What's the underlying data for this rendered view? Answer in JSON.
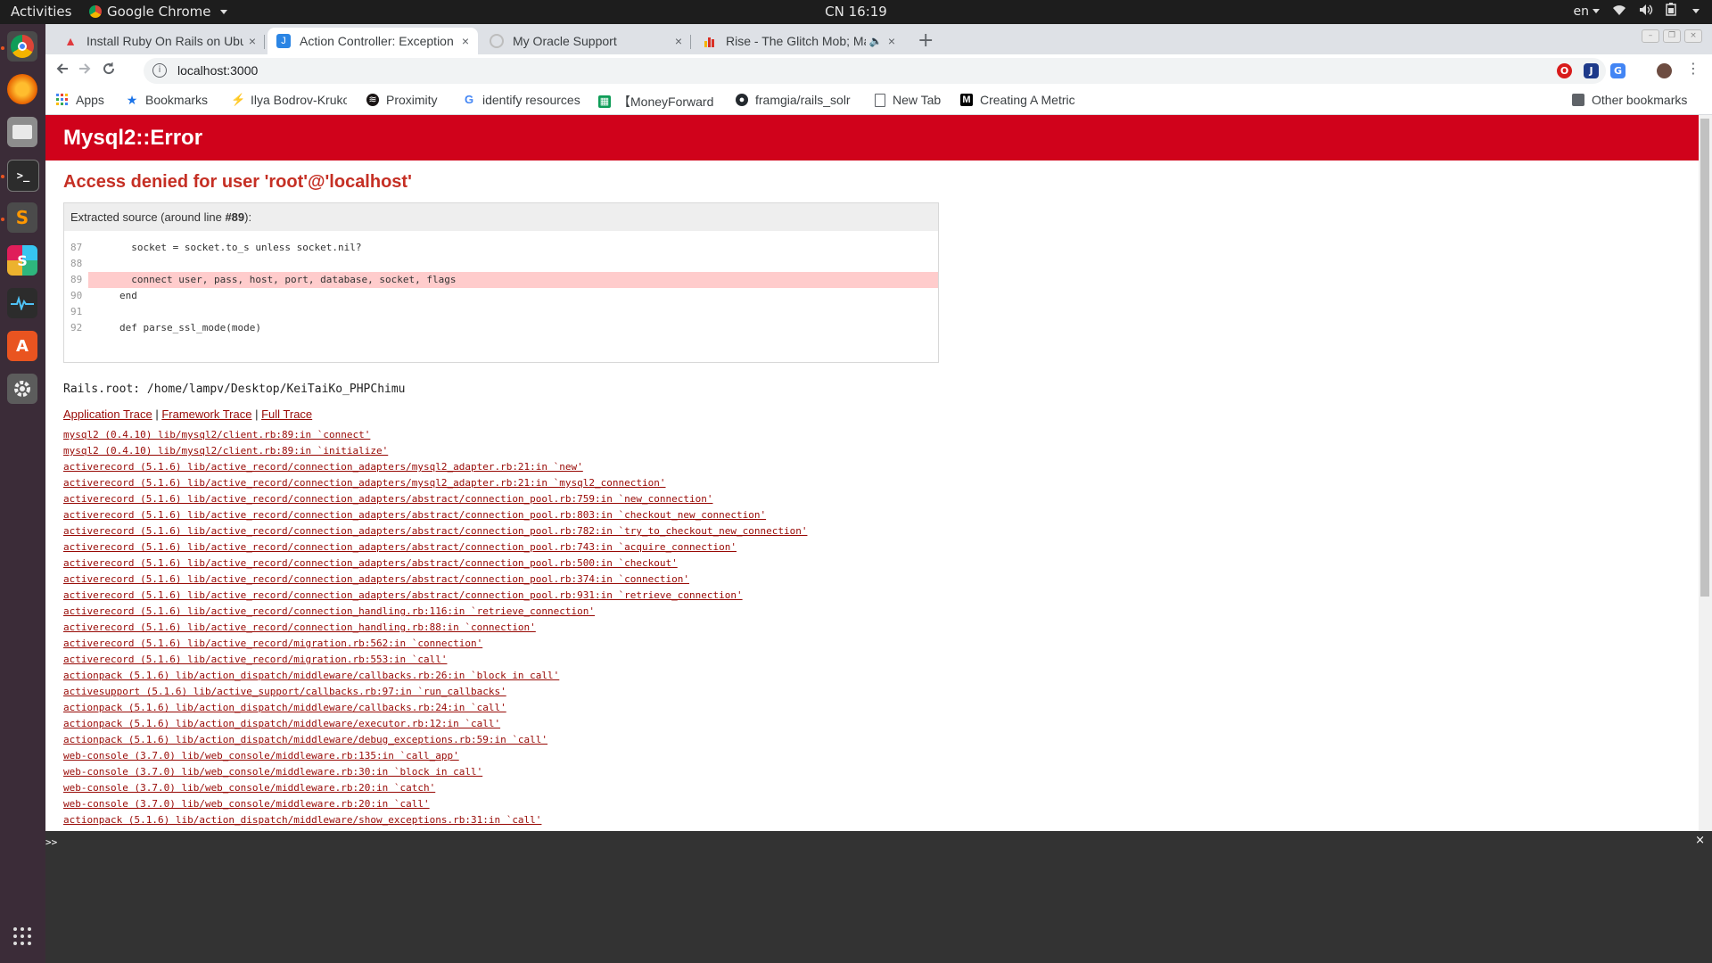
{
  "topbar": {
    "activities": "Activities",
    "app_name": "Google Chrome",
    "clock": "CN 16:19",
    "lang": "en"
  },
  "tabs": [
    {
      "title": "Install Ruby On Rails on Ubuntu",
      "close": "×",
      "favicon": "warning-icon",
      "color": "#e03a3e",
      "active": false
    },
    {
      "title": "Action Controller: Exception caught",
      "close": "×",
      "favicon": "j",
      "color": "#2b85e4",
      "active": true
    },
    {
      "title": "My Oracle Support",
      "close": "×",
      "favicon": "oracle-icon",
      "color": "#bdbdbd",
      "active": false
    },
    {
      "title": "Rise - The Glitch Mob; Mako",
      "close": "×",
      "favicon": "chart-icon",
      "color": "#d93025",
      "active": false
    }
  ],
  "toolbar": {
    "url": "localhost:3000"
  },
  "bookmarks": {
    "items": [
      {
        "label": "Apps",
        "icon": "apps-grid-icon"
      },
      {
        "label": "Bookmarks",
        "icon": "star-icon"
      },
      {
        "label": "Ilya Bodrov-Krukowski",
        "icon": "sitepoint-icon"
      },
      {
        "label": "Proximity",
        "icon": "spotify-icon"
      },
      {
        "label": "identify resources",
        "icon": "google-icon"
      },
      {
        "label": "【MoneyForward",
        "icon": "sheets-icon"
      },
      {
        "label": "framgia/rails_solr",
        "icon": "github-icon"
      },
      {
        "label": "New Tab",
        "icon": "page-icon"
      },
      {
        "label": "Creating A Metric",
        "icon": "medium-icon"
      }
    ],
    "other": "Other bookmarks"
  },
  "error": {
    "title": "Mysql2::Error",
    "message": "Access denied for user 'root'@'localhost'",
    "source_caption_prefix": "Extracted source (around line ",
    "source_line": "#89",
    "source_caption_suffix": "):",
    "source": [
      {
        "num": "87",
        "code": "  socket = socket.to_s unless socket.nil?"
      },
      {
        "num": "88",
        "code": ""
      },
      {
        "num": "89",
        "code": "  connect user, pass, host, port, database, socket, flags",
        "highlight": true
      },
      {
        "num": "90",
        "code": "end"
      },
      {
        "num": "91",
        "code": ""
      },
      {
        "num": "92",
        "code": "def parse_ssl_mode(mode)"
      }
    ],
    "rails_root": "Rails.root: /home/lampv/Desktop/KeiTaiKo_PHPChimu",
    "links": {
      "application": "Application Trace",
      "framework": "Framework Trace",
      "full": "Full Trace",
      "separator": " | "
    },
    "trace": [
      "mysql2 (0.4.10) lib/mysql2/client.rb:89:in `connect'",
      "mysql2 (0.4.10) lib/mysql2/client.rb:89:in `initialize'",
      "activerecord (5.1.6) lib/active_record/connection_adapters/mysql2_adapter.rb:21:in `new'",
      "activerecord (5.1.6) lib/active_record/connection_adapters/mysql2_adapter.rb:21:in `mysql2_connection'",
      "activerecord (5.1.6) lib/active_record/connection_adapters/abstract/connection_pool.rb:759:in `new_connection'",
      "activerecord (5.1.6) lib/active_record/connection_adapters/abstract/connection_pool.rb:803:in `checkout_new_connection'",
      "activerecord (5.1.6) lib/active_record/connection_adapters/abstract/connection_pool.rb:782:in `try_to_checkout_new_connection'",
      "activerecord (5.1.6) lib/active_record/connection_adapters/abstract/connection_pool.rb:743:in `acquire_connection'",
      "activerecord (5.1.6) lib/active_record/connection_adapters/abstract/connection_pool.rb:500:in `checkout'",
      "activerecord (5.1.6) lib/active_record/connection_adapters/abstract/connection_pool.rb:374:in `connection'",
      "activerecord (5.1.6) lib/active_record/connection_adapters/abstract/connection_pool.rb:931:in `retrieve_connection'",
      "activerecord (5.1.6) lib/active_record/connection_handling.rb:116:in `retrieve_connection'",
      "activerecord (5.1.6) lib/active_record/connection_handling.rb:88:in `connection'",
      "activerecord (5.1.6) lib/active_record/migration.rb:562:in `connection'",
      "activerecord (5.1.6) lib/active_record/migration.rb:553:in `call'",
      "actionpack (5.1.6) lib/action_dispatch/middleware/callbacks.rb:26:in `block in call'",
      "activesupport (5.1.6) lib/active_support/callbacks.rb:97:in `run_callbacks'",
      "actionpack (5.1.6) lib/action_dispatch/middleware/callbacks.rb:24:in `call'",
      "actionpack (5.1.6) lib/action_dispatch/middleware/executor.rb:12:in `call'",
      "actionpack (5.1.6) lib/action_dispatch/middleware/debug_exceptions.rb:59:in `call'",
      "web-console (3.7.0) lib/web_console/middleware.rb:135:in `call_app'",
      "web-console (3.7.0) lib/web_console/middleware.rb:30:in `block in call'",
      "web-console (3.7.0) lib/web_console/middleware.rb:20:in `catch'",
      "web-console (3.7.0) lib/web_console/middleware.rb:20:in `call'",
      "actionpack (5.1.6) lib/action_dispatch/middleware/show_exceptions.rb:31:in `call'"
    ]
  },
  "console": {
    "prompt": ">>",
    "close": "×"
  },
  "colors": {
    "error_header": "#d0021b",
    "error_text": "#c52f24",
    "trace_link": "#980905",
    "highlight": "#ffcccc",
    "dock": "#3b2c38"
  }
}
